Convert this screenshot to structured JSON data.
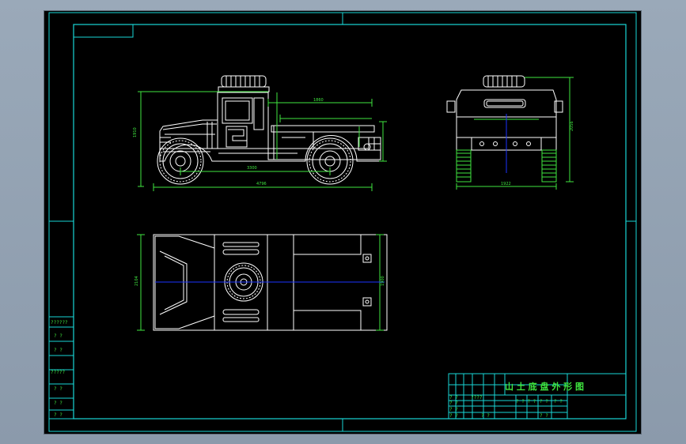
{
  "title_block": {
    "drawing_title": "山 土 底 盘 外 形 图"
  },
  "side_panel": {
    "rows": [
      "??????",
      "? ?",
      "? ?",
      "?????",
      "? ?",
      "? ?",
      "? ?"
    ]
  },
  "dimensions": {
    "side_view": [
      "4796",
      "3300",
      "1910",
      "1860"
    ],
    "front_view": [
      "1922",
      "2056"
    ],
    "top_view": [
      "2104",
      "1900"
    ]
  },
  "title_block_cells": [
    "? ?",
    "????",
    "? ?",
    "? ? ? ?",
    "? ?",
    "? ?",
    "? ?",
    "? ?",
    "? ?",
    "? ?"
  ],
  "colors": {
    "frame": "#19d6d6",
    "geometry": "#ffffff",
    "dimension": "#3fe63f",
    "centerline": "#1c33ff",
    "background": "#000000"
  }
}
